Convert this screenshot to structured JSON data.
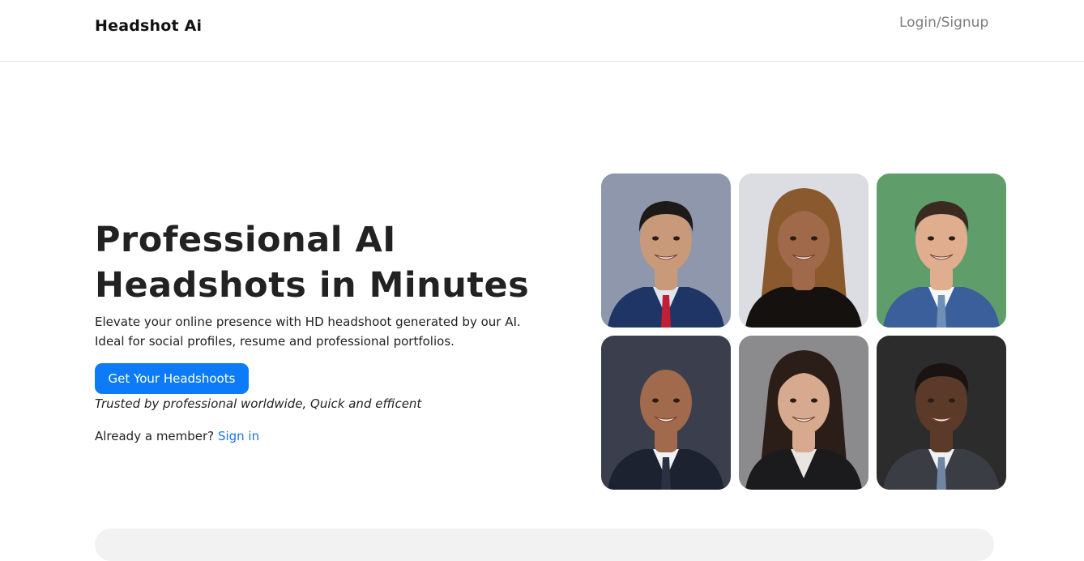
{
  "navbar": {
    "brand": "Headshot Ai",
    "login_label": "Login/Signup"
  },
  "hero": {
    "title_line1": "Professional AI",
    "title_line2": "Headshots in Minutes",
    "subtitle": "Elevate your online presence with HD headshoot generated by our AI. Ideal for social profiles, resume and professional portfolios.",
    "cta_label": "Get Your Headshoots",
    "trusted_text": "Trusted by professional worldwide, Quick and efficent",
    "member_text": "Already a member?",
    "signin_label": "Sign in"
  },
  "gallery": {
    "photos": [
      {
        "name": "man-navy-suit-red-tie",
        "bg": "#8f97ad",
        "skin": "#c99a7a",
        "hair": "#1e1a18",
        "clothes": "#1f3566",
        "shirt": "#dfe6f0",
        "accent": "#c21f37"
      },
      {
        "name": "woman-wavy-hair",
        "bg": "#dcdde3",
        "skin": "#a0694a",
        "hair": "#8a5a2e",
        "clothes": "#15110f",
        "shirt": "#15110f",
        "accent": "#d9b98a"
      },
      {
        "name": "man-blue-suit-green-bg",
        "bg": "#5f9e6a",
        "skin": "#e0ad8f",
        "hair": "#3a2a22",
        "clothes": "#3a5f9a",
        "shirt": "#f4f6f8",
        "accent": "#6d8fb8"
      },
      {
        "name": "bald-man-dark-suit",
        "bg": "#3b3f4d",
        "skin": "#a26a4c",
        "hair": "#a26a4c",
        "clothes": "#1c2230",
        "shirt": "#f0f2f5",
        "accent": "#2b3142"
      },
      {
        "name": "woman-dark-hair-blazer",
        "bg": "#8b8a8c",
        "skin": "#d7a98e",
        "hair": "#2b1e18",
        "clothes": "#1b1b1d",
        "shirt": "#e9e4df",
        "accent": "#1b1b1d"
      },
      {
        "name": "man-grey-suit-dark-bg",
        "bg": "#2c2c2d",
        "skin": "#5b3a29",
        "hair": "#1a1312",
        "clothes": "#3b3d44",
        "shirt": "#eef0f2",
        "accent": "#6f87a5"
      }
    ]
  }
}
